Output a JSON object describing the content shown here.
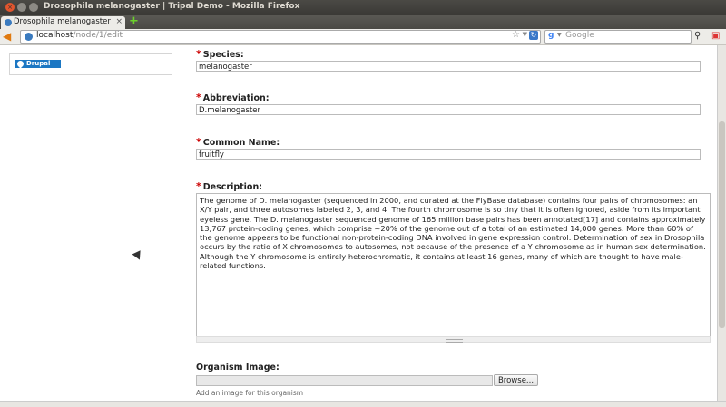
{
  "window": {
    "title": "Drosophila melanogaster | Tripal Demo - Mozilla Firefox"
  },
  "tab": {
    "title": "Drosophila melanogaster | Tri...",
    "close": "×",
    "new_tab": "+"
  },
  "nav": {
    "url_host": "localhost",
    "url_path": "/node/1/edit",
    "search_placeholder": "Google",
    "search_engine": "g"
  },
  "sidebar": {
    "badge": "Drupal"
  },
  "form": {
    "required_mark": "*",
    "species": {
      "label": "Species:",
      "value": "melanogaster"
    },
    "abbreviation": {
      "label": "Abbreviation:",
      "value": "D.melanogaster"
    },
    "common_name": {
      "label": "Common Name:",
      "value": "fruitfly"
    },
    "description": {
      "label": "Description:",
      "value": "The genome of D. melanogaster (sequenced in 2000, and curated at the FlyBase database) contains four pairs of chromosomes: an X/Y pair, and three autosomes labeled 2, 3, and 4. The fourth chromosome is so tiny that it is often ignored, aside from its important eyeless gene. The D. melanogaster sequenced genome of 165 million base pairs has been annotated[17] and contains approximately 13,767 protein-coding genes, which comprise ~20% of the genome out of a total of an estimated 14,000 genes. More than 60% of the genome appears to be functional non-protein-coding DNA involved in gene expression control. Determination of sex in Drosophila occurs by the ratio of X chromosomes to autosomes, not because of the presence of a Y chromosome as in human sex determination. Although the Y chromosome is entirely heterochromatic, it contains at least 16 genes, many of which are thought to have male-related functions."
    },
    "organism_image": {
      "label": "Organism Image:",
      "browse_label": "Browse...",
      "description": "Add an image for this organism"
    }
  },
  "colors": {
    "required": "#cc0000",
    "drupal_blue": "#1c77c3"
  }
}
